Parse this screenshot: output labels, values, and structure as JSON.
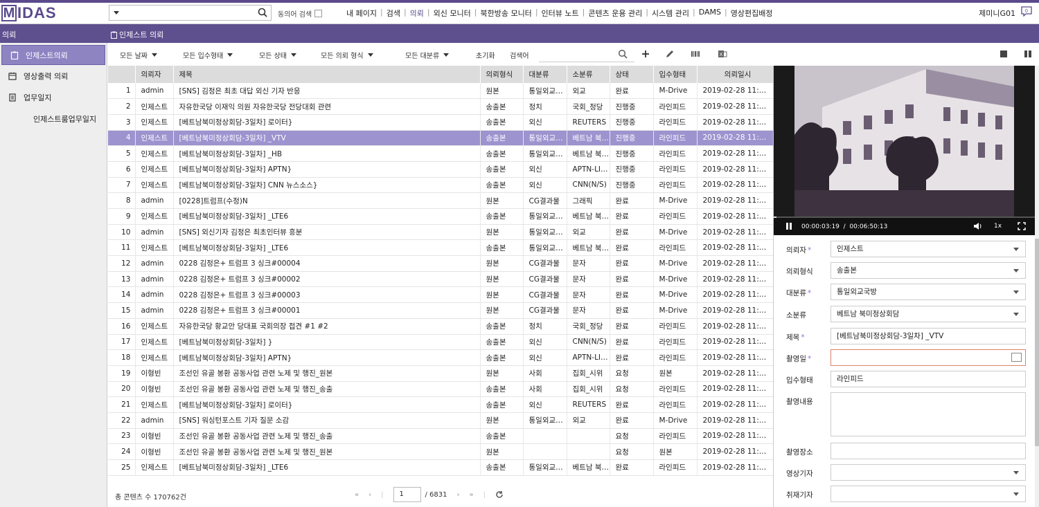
{
  "logo": {
    "first": "M",
    "rest": "IDAS"
  },
  "header": {
    "synonym_label": "동의어 검색",
    "nav": [
      "내 페이지",
      "검색",
      "의뢰",
      "외신 모니터",
      "북한방송 모니터",
      "인터뷰 노트",
      "콘텐츠 운용 관리",
      "시스템 관리",
      "DAMS",
      "영상편집배정"
    ],
    "active_nav": "의뢰",
    "user": "제미니G01",
    "notification_count": "0"
  },
  "subbar": {
    "section": "의뢰",
    "page_title": "인제스트 의뢰"
  },
  "sidebar": {
    "items": [
      {
        "label": "인제스트의뢰",
        "icon": "clipboard-icon",
        "active": true
      },
      {
        "label": "영상출력 의뢰",
        "icon": "calendar-icon",
        "active": false
      },
      {
        "label": "업무일지",
        "icon": "document-icon",
        "active": false
      },
      {
        "label": "인제스트룸업무일지",
        "icon": "",
        "active": false
      }
    ]
  },
  "toolbar": {
    "date": "모든 날짜",
    "intake": "모든 입수형태",
    "status": "모든 상태",
    "type": "모든 의뢰 형식",
    "category": "모든 대분류",
    "reset": "초기화",
    "search_word": "검색어"
  },
  "table": {
    "columns": [
      "",
      "의뢰자",
      "제목",
      "의뢰형식",
      "대분류",
      "소분류",
      "상태",
      "입수형태",
      "의뢰일시"
    ],
    "selected_index": 3,
    "rows": [
      [
        "1",
        "admin",
        "[SNS] 김정은 최초 대답 외신 기자 반응",
        "원본",
        "통일외교국방",
        "외교",
        "완료",
        "M-Drive",
        "2019-02-28 11:42:12"
      ],
      [
        "2",
        "인제스트",
        "자유한국당 이재익 의원 자유한국당 전당대회 관련",
        "송출본",
        "정치",
        "국회_정당",
        "진행중",
        "라인피드",
        "2019-02-28 11:41:31"
      ],
      [
        "3",
        "인제스트",
        "[베트남북미정상회담-3일차] 로이터}",
        "송출본",
        "외신",
        "REUTERS",
        "진행중",
        "라인피드",
        "2019-02-28 11:39:40"
      ],
      [
        "4",
        "인제스트",
        "[베트남북미정상회담-3일차] _VTV",
        "송출본",
        "통일외교국방",
        "베트남 북미정상회담",
        "진행중",
        "라인피드",
        "2019-02-28 11:39:02"
      ],
      [
        "5",
        "인제스트",
        "[베트남북미정상회담-3일차] _HB",
        "송출본",
        "통일외교국방",
        "베트남 북미정상회담",
        "진행중",
        "라인피드",
        "2019-02-28 11:38:32"
      ],
      [
        "6",
        "인제스트",
        "[베트남북미정상회담-3일차] APTN}",
        "송출본",
        "외신",
        "APTN-LIVE",
        "진행중",
        "라인피드",
        "2019-02-28 11:38:25"
      ],
      [
        "7",
        "인제스트",
        "[베트남북미정상회담-3일차] CNN 뉴스소스}",
        "송출본",
        "외신",
        "CNN(N/S)",
        "진행중",
        "라인피드",
        "2019-02-28 11:38:13"
      ],
      [
        "8",
        "admin",
        "[0228]트럼프(수정)N",
        "원본",
        "CG결과물",
        "그래픽",
        "완료",
        "M-Drive",
        "2019-02-28 11:37:26"
      ],
      [
        "9",
        "인제스트",
        "[베트남북미정상회담-3일차] _LTE6",
        "송출본",
        "통일외교국방",
        "베트남 북미정상회담",
        "완료",
        "라인피드",
        "2019-02-28 11:36:19"
      ],
      [
        "10",
        "admin",
        "[SNS] 외신기자 김정은 최초인터뷰 흥분",
        "원본",
        "통일외교국방",
        "외교",
        "완료",
        "M-Drive",
        "2019-02-28 11:33:56"
      ],
      [
        "11",
        "인제스트",
        "[베트남북미정상회담-3일차] _LTE6",
        "송출본",
        "통일외교국방",
        "베트남 북미정상회담",
        "완료",
        "라인피드",
        "2019-02-28 11:29:17"
      ],
      [
        "12",
        "admin",
        "0228 김정은+ 트럼프 3 싱크#00004",
        "원본",
        "CG결과물",
        "문자",
        "완료",
        "M-Drive",
        "2019-02-28 11:24:41"
      ],
      [
        "13",
        "admin",
        "0228 김정은+ 트럼프 3 싱크#00002",
        "원본",
        "CG결과물",
        "문자",
        "완료",
        "M-Drive",
        "2019-02-28 11:24:41"
      ],
      [
        "14",
        "admin",
        "0228 김정은+ 트럼프 3 싱크#00003",
        "원본",
        "CG결과물",
        "문자",
        "완료",
        "M-Drive",
        "2019-02-28 11:24:41"
      ],
      [
        "15",
        "admin",
        "0228 김정은+ 트럼프 3 싱크#00001",
        "원본",
        "CG결과물",
        "문자",
        "완료",
        "M-Drive",
        "2019-02-28 11:24:41"
      ],
      [
        "16",
        "인제스트",
        "자유한국당 황교안 당대표 국회의장 접견 #1 #2",
        "송출본",
        "정치",
        "국회_정당",
        "완료",
        "라인피드",
        "2019-02-28 11:22:13"
      ],
      [
        "17",
        "인제스트",
        "[베트남북미정상회담-3일차] }",
        "송출본",
        "외신",
        "CNN(N/S)",
        "완료",
        "라인피드",
        "2019-02-28 11:21:56"
      ],
      [
        "18",
        "인제스트",
        "[베트남북미정상회담-3일차] APTN}",
        "송출본",
        "외신",
        "APTN-LIVE",
        "완료",
        "라인피드",
        "2019-02-28 11:21:20"
      ],
      [
        "19",
        "이형빈",
        "조선인 유골 봉환 공동사업 관련 노제 및 행진_원본",
        "원본",
        "사회",
        "집회_시위",
        "요청",
        "원본",
        "2019-02-28 11:21:00"
      ],
      [
        "20",
        "이형빈",
        "조선인 유골 봉환 공동사업 관련 노제 및 행진_송출",
        "송출본",
        "사회",
        "집회_시위",
        "요청",
        "라인피드",
        "2019-02-28 11:21:00"
      ],
      [
        "21",
        "인제스트",
        "[베트남북미정상회담-3일차] 로이터}",
        "송출본",
        "외신",
        "REUTERS",
        "완료",
        "라인피드",
        "2019-02-28 11:20:58"
      ],
      [
        "22",
        "admin",
        "[SNS] 워싱턴포스트 기자 질문 소감",
        "원본",
        "통일외교국방",
        "외교",
        "완료",
        "M-Drive",
        "2019-02-28 11:20:55"
      ],
      [
        "23",
        "이형빈",
        "조선인 유골 봉환 공동사업 관련 노제 및 행진_송출",
        "송출본",
        "",
        "",
        "요청",
        "라인피드",
        "2019-02-28 11:20:16"
      ],
      [
        "24",
        "이형빈",
        "조선인 유골 봉환 공동사업 관련 노제 및 행진_원본",
        "원본",
        "",
        "",
        "요청",
        "원본",
        "2019-02-28 11:20:16"
      ],
      [
        "25",
        "인제스트",
        "[베트남북미정상회담-3일차] _LTE6",
        "송출본",
        "통일외교국방",
        "베트남 북미정상회담",
        "완료",
        "라인피드",
        "2019-02-28 11:20:04"
      ]
    ]
  },
  "footer": {
    "total": "총 콘텐츠 수 170762건",
    "page": "1",
    "page_total": "/ 6831"
  },
  "player": {
    "current_time": "00:00:03:19",
    "separator": "/",
    "total_time": "00:06:50:13",
    "speed": "1x",
    "progress": 0.01
  },
  "form": {
    "requester_label": "의뢰자",
    "requester_value": "인제스트",
    "type_label": "의뢰형식",
    "type_value": "송출본",
    "category_label": "대분류",
    "category_value": "통일외교국방",
    "subcategory_label": "소분류",
    "subcategory_value": "베트남 북미정상회담",
    "title_label": "제목",
    "title_value": "[베트남북미정상회담-3일차] _VTV",
    "shoot_date_label": "촬영일",
    "shoot_date_value": "",
    "intake_label": "입수형태",
    "intake_value": "라인피드",
    "content_label": "촬영내용",
    "content_value": "",
    "place_label": "촬영장소",
    "place_value": "",
    "camera_reporter_label": "영상기자",
    "camera_reporter_value": "",
    "reporter_label": "취재기자",
    "reporter_value": ""
  },
  "colors": {
    "brand": "#5e4f8f",
    "selected_row": "#9d93cf",
    "active_side": "#8e84c2",
    "required": "#9b6bd6",
    "error_border": "#d9826b"
  }
}
